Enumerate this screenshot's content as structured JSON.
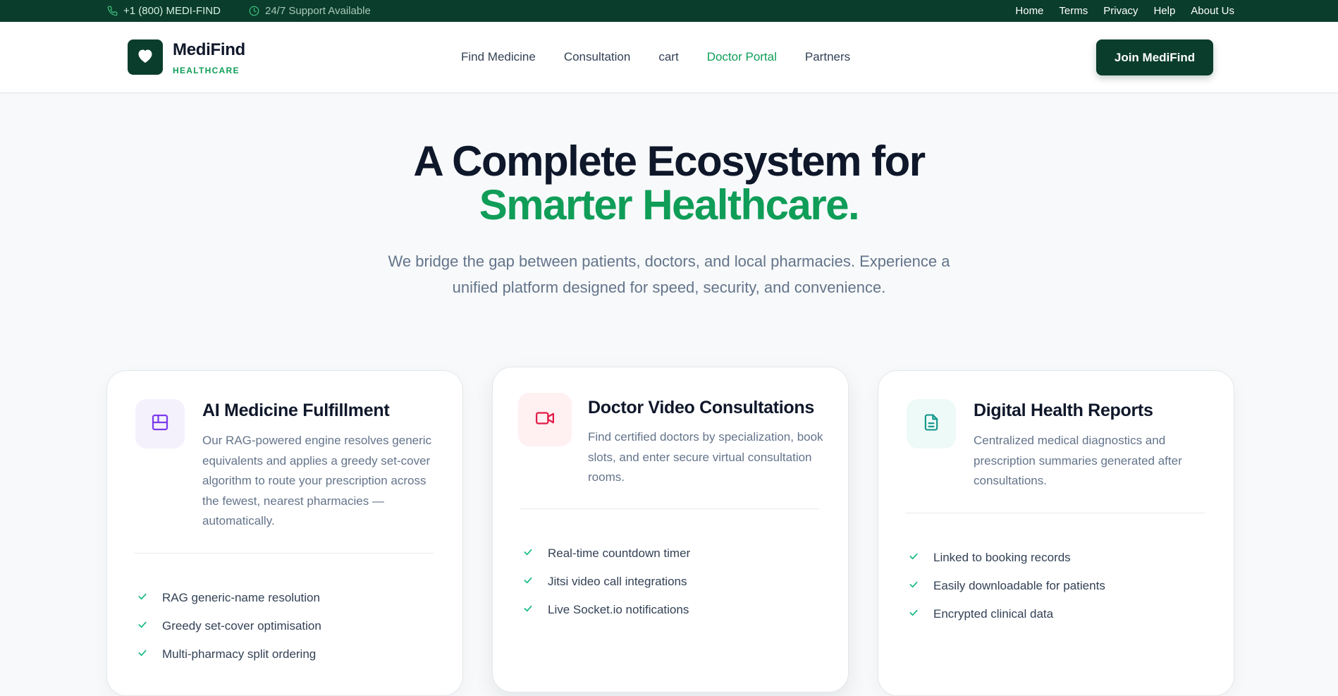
{
  "topbar": {
    "phone": "+1 (800) MEDI-FIND",
    "support": "24/7 Support Available",
    "links": [
      "Home",
      "Terms",
      "Privacy",
      "Help",
      "About Us"
    ],
    "icons": {
      "phone": "phone-icon",
      "clock": "clock-icon"
    }
  },
  "header": {
    "brand": {
      "name": "MediFind",
      "tagline": "HEALTHCARE",
      "icon": "heart-icon"
    },
    "nav": [
      "Find Medicine",
      "Consultation",
      "cart",
      "Doctor Portal",
      "Partners"
    ],
    "active_nav": "Doctor Portal",
    "cta": "Join MediFind"
  },
  "hero": {
    "title_line1": "A Complete Ecosystem for",
    "title_line2": "Smarter Healthcare.",
    "subtitle": "We bridge the gap between patients, doctors, and local pharmacies. Experience a unified platform designed for speed, security, and convenience."
  },
  "features": [
    {
      "icon": "layout-icon",
      "title": "AI Medicine Fulfillment",
      "description": "Our RAG-powered engine resolves generic equivalents and applies a greedy set-cover algorithm to route your prescription across the fewest, nearest pharmacies — automatically.",
      "bullets": [
        "RAG generic-name resolution",
        "Greedy set-cover optimisation",
        "Multi-pharmacy split ordering"
      ]
    },
    {
      "icon": "video-icon",
      "title": "Doctor Video Consultations",
      "description": "Find certified doctors by specialization, book slots, and enter secure virtual consultation rooms.",
      "bullets": [
        "Real-time countdown timer",
        "Jitsi video call integrations",
        "Live Socket.io notifications"
      ]
    },
    {
      "icon": "file-text-icon",
      "title": "Digital Health Reports",
      "description": "Centralized medical diagnostics and prescription summaries generated after consultations.",
      "bullets": [
        "Linked to booking records",
        "Easily downloadable for patients",
        "Encrypted clinical data"
      ]
    }
  ],
  "colors": {
    "dark_green": "#0a3d2b",
    "accent_green": "#0f9d58",
    "purple": "#7c3aed",
    "rose": "#e11d48",
    "teal": "#0d9488"
  }
}
